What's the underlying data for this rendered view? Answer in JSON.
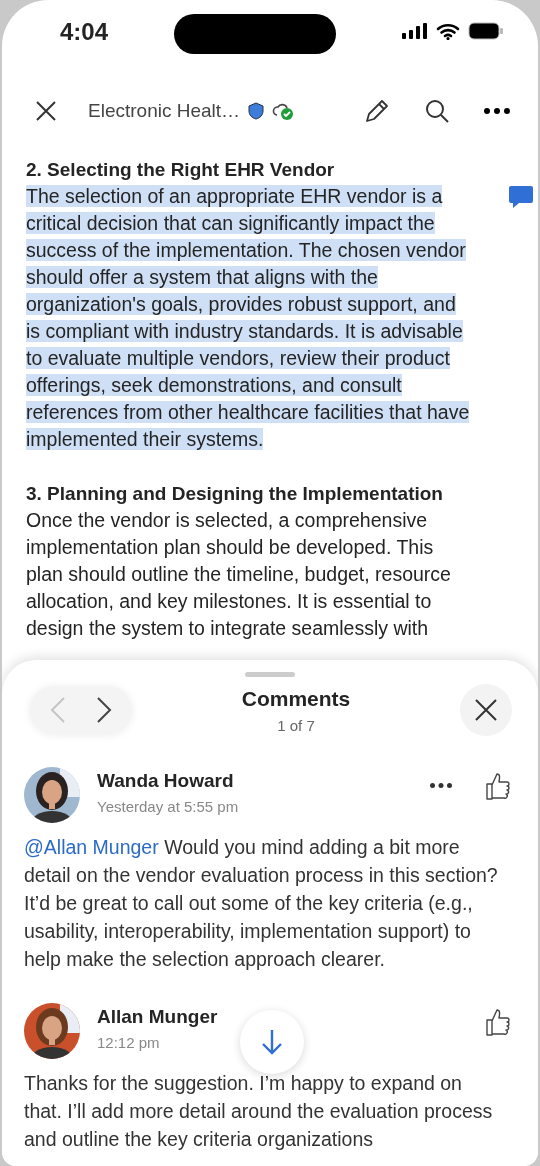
{
  "status_bar": {
    "time": "4:04"
  },
  "toolbar": {
    "title": "Electronic Healt…",
    "sensitivity_label": true,
    "synced": true
  },
  "document": {
    "sections": [
      {
        "heading": "2. Selecting the Right EHR Vendor",
        "body": "The selection of an appropriate EHR vendor is a critical decision that can significantly impact the success of the implementation. The chosen vendor should offer a system that aligns with the organization's goals, provides robust support, and is compliant with industry standards. It is advisable to evaluate multiple vendors, review their product offerings, seek demonstrations, and consult references from other healthcare facilities that have implemented their systems.",
        "selected": true,
        "has_comment": true
      },
      {
        "heading": "3. Planning and Designing the Implementation",
        "body": "Once the vendor is selected, a comprehensive implementation plan should be developed. This plan should outline the timeline, budget, resource allocation, and key milestones. It is essential to design the system to integrate seamlessly with",
        "selected": false,
        "has_comment": false
      }
    ]
  },
  "comments_panel": {
    "title": "Comments",
    "position": "1 of 7",
    "prev_disabled": true,
    "next_disabled": false,
    "comments": [
      {
        "author": "Wanda Howard",
        "time": "Yesterday at 5:55 pm",
        "mention": "@Allan Munger",
        "text": "Would you mind adding a bit more detail on the vendor evaluation process in this section? It’d be great to call out some of the key criteria (e.g., usability, interoperability, implementation support) to help make the selection approach clearer.",
        "has_menu": true,
        "liked": false
      },
      {
        "author": "Allan Munger",
        "time": "12:12 pm",
        "text": "Thanks for the suggestion. I’m happy to expand on that. I’ll add more detail around the evaluation process and outline the key criteria organizations",
        "has_menu": false,
        "liked": false
      }
    ]
  }
}
